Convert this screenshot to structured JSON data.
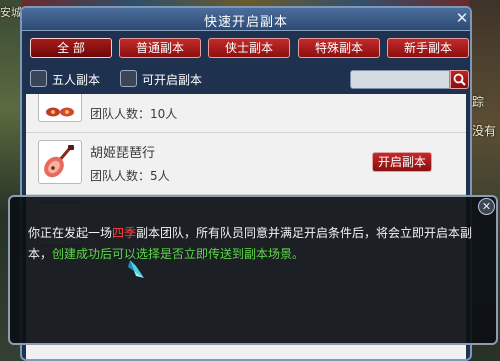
{
  "background": {
    "left_label": "安城",
    "right_labels": [
      "踪",
      "没有"
    ]
  },
  "window": {
    "title": "快速开启副本",
    "close_icon": "close-x-icon"
  },
  "tabs": [
    {
      "label": "全 部",
      "active": true
    },
    {
      "label": "普通副本",
      "active": false
    },
    {
      "label": "侠士副本",
      "active": false
    },
    {
      "label": "特殊副本",
      "active": false
    },
    {
      "label": "新手副本",
      "active": false
    }
  ],
  "filters": {
    "five_player_label": "五人副本",
    "openable_label": "可开启副本",
    "search_value": "",
    "search_icon": "search-icon"
  },
  "dungeons": [
    {
      "name": "",
      "members_text": "团队人数：10人",
      "open_label": "",
      "icon": "mask-icon"
    },
    {
      "name": "胡姬琵琶行",
      "members_text": "团队人数：5人",
      "open_label": "开启副本",
      "icon": "pipa-icon"
    }
  ],
  "dialog": {
    "text_before": "你正在发起一场",
    "text_highlight": "四季",
    "text_after": "副本团队，所有队员同意并满足开启条件后，将会立即开启本副本，",
    "text_green": "创建成功后可以选择是否立即传送到副本场景。",
    "close_icon": "close-circle-icon"
  },
  "colors": {
    "tab_red": "#b01f1f",
    "highlight_red": "#ff3d3d",
    "highlight_green": "#5dd846",
    "window_blue": "#1e3250"
  }
}
